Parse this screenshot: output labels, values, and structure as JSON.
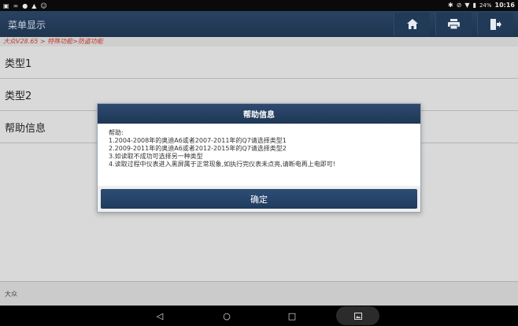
{
  "statusbar": {
    "left_icons": [
      "image-icon",
      "voicemail-icon",
      "chat-icon",
      "warning-icon",
      "android-icon"
    ],
    "battery": "24%",
    "time": "10:16"
  },
  "header": {
    "title": "菜单显示",
    "buttons": [
      "home-icon",
      "print-icon",
      "exit-icon"
    ]
  },
  "breadcrumb": "大众V28.65 > 特殊功能>防盗功能",
  "menu": {
    "items": [
      {
        "label": "类型1"
      },
      {
        "label": "类型2"
      },
      {
        "label": "帮助信息"
      }
    ]
  },
  "dialog": {
    "title": "帮助信息",
    "lines": [
      "帮助:",
      "1.2004-2008年的奥迪A6或者2007-2011年的Q7请选择类型1",
      "2.2009-2011年的奥迪A6或者2012-2015年的Q7请选择类型2",
      "3.如读取不成功可选择另一种类型",
      "4.读取过程中仪表进入黑屏属于正常现象,如执行完仪表未点亮,请断电再上电即可!"
    ],
    "ok_label": "确定"
  },
  "footer": {
    "text": "大众"
  },
  "navbar": {
    "back": "◁",
    "home": "○",
    "recent": "□",
    "screenshot": "screenshot-icon"
  },
  "colors": {
    "header_bg": "#233c5b",
    "breadcrumb_text": "#c0392b",
    "button_blue": "#274468"
  }
}
